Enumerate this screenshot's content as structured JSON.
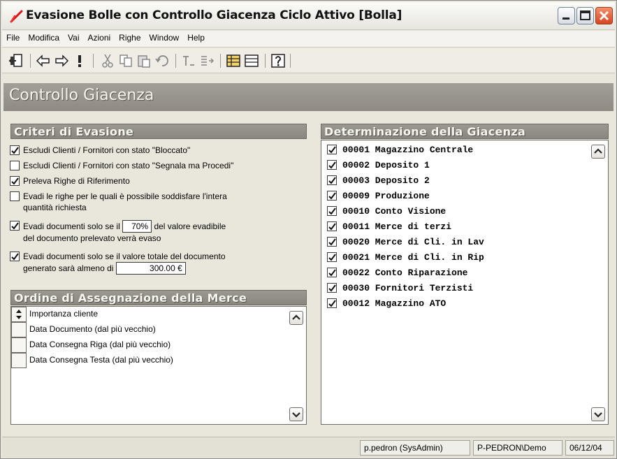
{
  "window": {
    "title": "Evasione Bolle con Controllo Giacenza Ciclo Attivo [Bolla]"
  },
  "menu": [
    "File",
    "Modifica",
    "Vai",
    "Azioni",
    "Righe",
    "Window",
    "Help"
  ],
  "toolbar": {
    "icons": [
      "exit-icon",
      "back-arrow-icon",
      "forward-arrow-icon",
      "exclamation-icon",
      "cut-icon",
      "copy-icon",
      "paste-icon",
      "undo-icon",
      "align-icon",
      "indent-icon",
      "grid-icon",
      "table-icon",
      "help-icon"
    ]
  },
  "section": {
    "title": "Controllo Giacenza"
  },
  "criteri": {
    "header": "Criteri di Evasione",
    "items": [
      {
        "label": "Escludi Clienti / Fornitori con stato \"Bloccato\"",
        "checked": true
      },
      {
        "label": "Escludi Clienti / Fornitori con stato \"Segnala ma Procedi\"",
        "checked": false
      },
      {
        "label": "Preleva Righe di Riferimento",
        "checked": true
      },
      {
        "label_line1": "Evadi le righe per le quali è possibile soddisfare l'intera",
        "label_line2": "quantità richiesta",
        "checked": false
      },
      {
        "label_pre": "Evadi documenti solo se il",
        "value": "70%",
        "label_post": "del valore evadibile",
        "label_line2": "del documento prelevato verrà evaso",
        "checked": true
      },
      {
        "label_line1": "Evadi documenti solo se il valore totale del documento",
        "label_pre2": "generato sarà almeno di",
        "value": "300.00 €",
        "checked": true
      }
    ]
  },
  "ordine": {
    "header": "Ordine di Assegnazione della Merce",
    "items": [
      {
        "label": "Importanza cliente",
        "sort_icon": true
      },
      {
        "label": "Data Documento (dal più vecchio)",
        "sort_icon": false
      },
      {
        "label": "Data Consegna Riga (dal più vecchio)",
        "sort_icon": false
      },
      {
        "label": "Data Consegna Testa (dal più vecchio)",
        "sort_icon": false
      }
    ]
  },
  "giacenza": {
    "header": "Determinazione della Giacenza",
    "items": [
      {
        "label": "00001 Magazzino Centrale",
        "checked": true
      },
      {
        "label": "00002 Deposito 1",
        "checked": true
      },
      {
        "label": "00003 Deposito 2",
        "checked": true
      },
      {
        "label": "00009 Produzione",
        "checked": true
      },
      {
        "label": "00010 Conto Visione",
        "checked": true
      },
      {
        "label": "00011 Merce di terzi",
        "checked": true
      },
      {
        "label": "00020 Merce di Cli. in Lav",
        "checked": true
      },
      {
        "label": "00021 Merce di Cli. in Rip",
        "checked": true
      },
      {
        "label": "00022 Conto Riparazione",
        "checked": true
      },
      {
        "label": "00030 Fornitori Terzisti",
        "checked": true
      },
      {
        "label": "00012 Magazzino ATO",
        "checked": true
      }
    ]
  },
  "status": {
    "user": "p.pedron (SysAdmin)",
    "machine": "P-PEDRON\\Demo",
    "date": "06/12/04"
  }
}
